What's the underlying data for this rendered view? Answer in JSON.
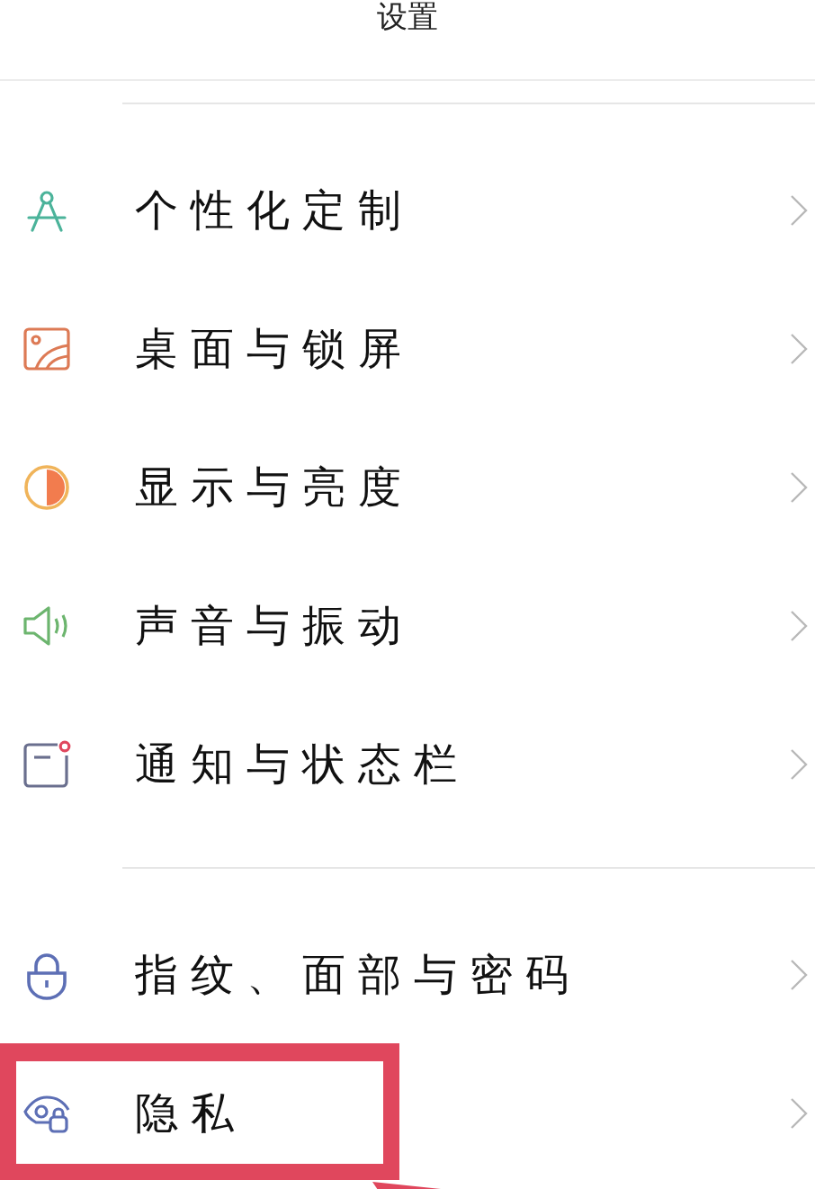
{
  "header": {
    "title": "设置"
  },
  "sections": [
    {
      "items": [
        {
          "label": "个性化定制",
          "highlighted": false
        },
        {
          "label": "桌面与锁屏",
          "highlighted": false
        },
        {
          "label": "显示与亮度",
          "highlighted": false
        },
        {
          "label": "声音与振动",
          "highlighted": false
        },
        {
          "label": "通知与状态栏",
          "highlighted": false
        }
      ]
    },
    {
      "items": [
        {
          "label": "指纹、面部与密码",
          "highlighted": false
        },
        {
          "label": "隐私",
          "highlighted": true
        }
      ]
    }
  ]
}
